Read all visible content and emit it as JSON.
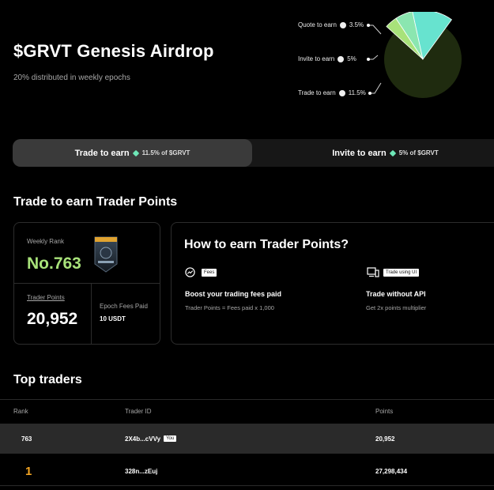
{
  "hero": {
    "title": "$GRVT Genesis Airdrop",
    "subtitle": "20% distributed in weekly epochs"
  },
  "distribution": {
    "slices": [
      {
        "label": "Quote to earn",
        "percent": "3.5%",
        "value": 3.5,
        "color": "#a8e27a"
      },
      {
        "label": "Invite to earn",
        "percent": "5%",
        "value": 5,
        "color": "#8be6b0"
      },
      {
        "label": "Trade to earn",
        "percent": "11.5%",
        "value": 11.5,
        "color": "#67e3cf"
      }
    ],
    "remainder_color": "#1f2b0f"
  },
  "tabs": [
    {
      "label": "Trade to earn",
      "sub": "11.5% of $GRVT",
      "active": true
    },
    {
      "label": "Invite to earn",
      "sub": "5% of $GRVT",
      "active": false
    }
  ],
  "section_title": "Trade to earn Trader Points",
  "rank_card": {
    "weekly_rank_label": "Weekly Rank",
    "weekly_rank_value": "No.763",
    "trader_points_label": "Trader Points",
    "trader_points_value": "20,952",
    "epoch_fees_label": "Epoch Fees Paid",
    "epoch_fees_value": "10 USDT"
  },
  "how_card": {
    "title": "How to earn Trader Points?",
    "items": [
      {
        "tag": "Fees",
        "heading": "Boost your trading fees paid",
        "desc": "Trader Points = Fees paid x 1,000",
        "icon": "trend-up-icon"
      },
      {
        "tag": "Trade using UI",
        "heading": "Trade without API",
        "desc": "Get 2x points multiplier",
        "icon": "devices-icon"
      }
    ]
  },
  "top_traders": {
    "title": "Top traders",
    "columns": [
      "Rank",
      "Trader ID",
      "Points"
    ],
    "you_row": {
      "rank": "763",
      "trader_id": "2X4b...cVVy",
      "you_tag": "You",
      "points": "20,952"
    },
    "rows": [
      {
        "rank": "1",
        "trader_id": "328n...zEuj",
        "points": "27,298,434"
      }
    ]
  }
}
